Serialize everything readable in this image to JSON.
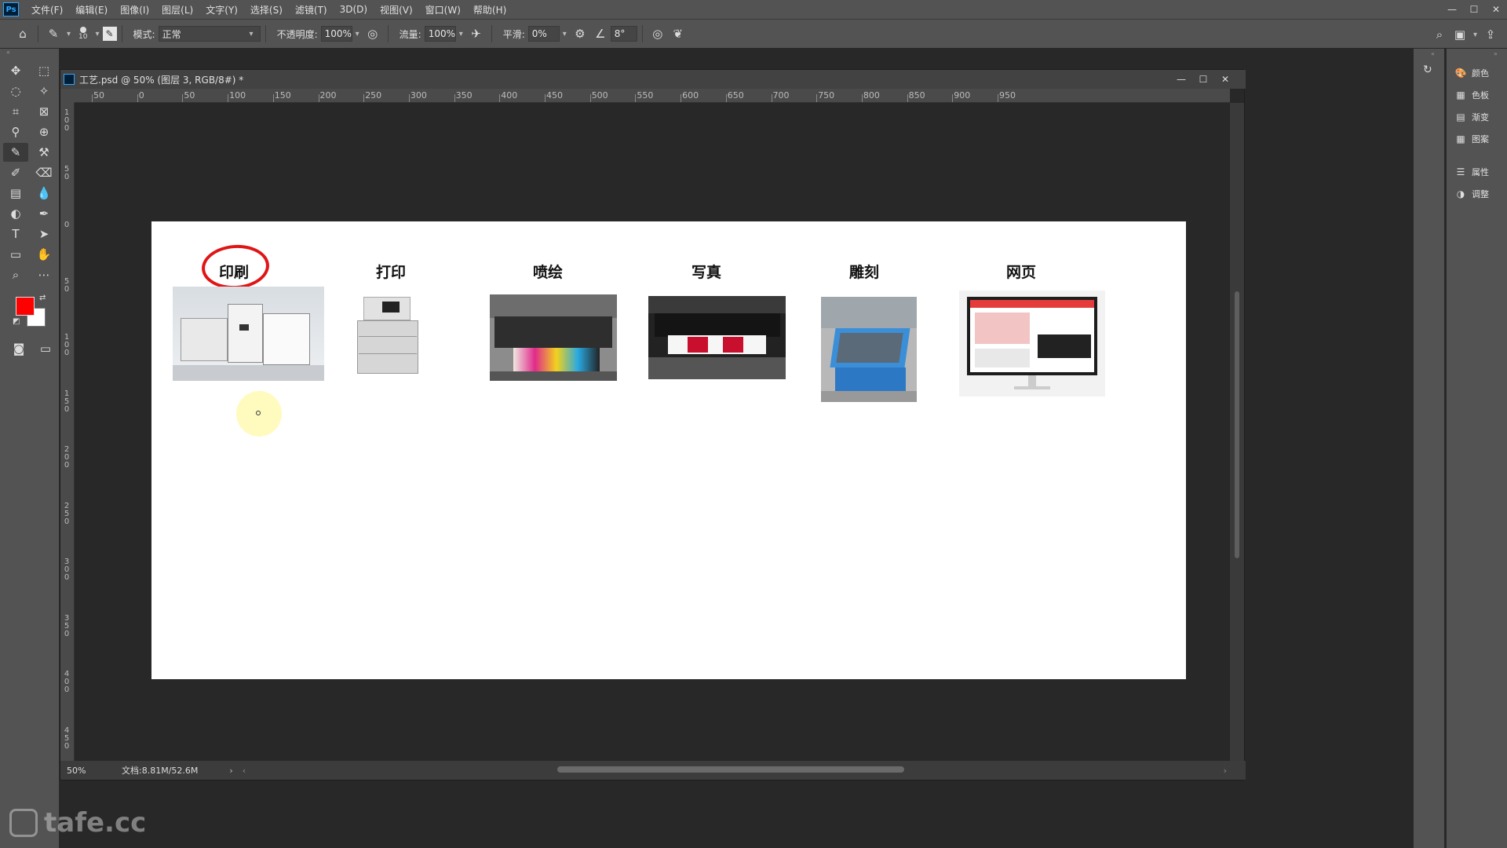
{
  "menubar": {
    "logo": "Ps",
    "items": [
      "文件(F)",
      "编辑(E)",
      "图像(I)",
      "图层(L)",
      "文字(Y)",
      "选择(S)",
      "滤镜(T)",
      "3D(D)",
      "视图(V)",
      "窗口(W)",
      "帮助(H)"
    ],
    "minimize": "—",
    "maximize": "☐",
    "close": "✕"
  },
  "optbar": {
    "brush_size": "10",
    "mode_label": "模式:",
    "mode_value": "正常",
    "opacity_label": "不透明度:",
    "opacity_value": "100%",
    "flow_label": "流量:",
    "flow_value": "100%",
    "smooth_label": "平滑:",
    "smooth_value": "0%",
    "angle_value": "8°"
  },
  "colors": {
    "foreground": "#ff0000",
    "background": "#ffffff"
  },
  "document": {
    "tab_title": "工艺.psd @ 50% (图层 3, RGB/8#) *",
    "zoom": "50%",
    "doc_info": "文档:8.81M/52.6M",
    "hruler_labels": [
      "50",
      "0",
      "50",
      "100",
      "150",
      "200",
      "250",
      "300",
      "350",
      "400",
      "450",
      "500",
      "550",
      "600",
      "650",
      "700",
      "750",
      "800",
      "850",
      "900",
      "950"
    ],
    "vruler_labels": [
      "1\n0\n0",
      "5\n0",
      "0",
      "5\n0",
      "1\n0\n0",
      "1\n5\n0",
      "2\n0\n0",
      "2\n5\n0",
      "3\n0\n0",
      "3\n5\n0",
      "4\n0\n0",
      "4\n5\n0"
    ]
  },
  "canvas": {
    "categories": [
      {
        "label": "印刷",
        "image": "digital-press-photo"
      },
      {
        "label": "打印",
        "image": "office-printer-photo"
      },
      {
        "label": "喷绘",
        "image": "wide-format-printer-photo"
      },
      {
        "label": "写真",
        "image": "photo-printer-photo"
      },
      {
        "label": "雕刻",
        "image": "cnc-engraver-photo"
      },
      {
        "label": "网页",
        "image": "monitor-webpage-photo"
      }
    ]
  },
  "right_panel": {
    "items": [
      "颜色",
      "色板",
      "渐变",
      "图案",
      "属性",
      "调整"
    ]
  },
  "watermark": "tafe.cc"
}
